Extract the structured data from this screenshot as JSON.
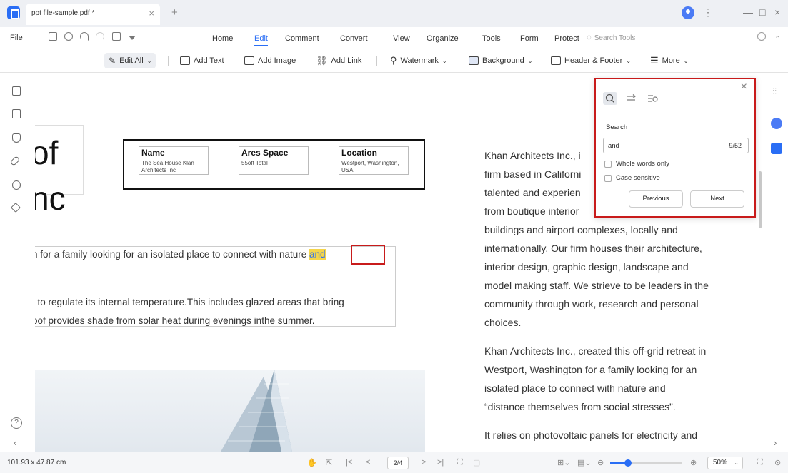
{
  "titlebar": {
    "tab_title": "ppt file-sample.pdf *",
    "tab_close": "×",
    "tab_add": "+",
    "win_menu": "⋮",
    "win_min": "—",
    "win_max": "□",
    "win_close": "×"
  },
  "menubar": {
    "file": "File",
    "items": [
      "Home",
      "Edit",
      "Comment",
      "Convert",
      "View",
      "Organize",
      "Tools",
      "Form",
      "Protect"
    ],
    "active": "Edit",
    "search_tools": "Search Tools"
  },
  "toolbar": {
    "edit_all": "Edit All",
    "add_text": "Add Text",
    "add_image": "Add Image",
    "add_link": "Add Link",
    "watermark": "Watermark",
    "background": "Background",
    "header_footer": "Header & Footer",
    "more": "More"
  },
  "document": {
    "big_line1": "of",
    "big_line2": "nc",
    "table": [
      {
        "header": "Name",
        "value": "The Sea House Klan Architects Inc"
      },
      {
        "header": "Ares Space",
        "value": "55oft Total"
      },
      {
        "header": "Location",
        "value": "Westport, Washington, USA"
      }
    ],
    "left_lines": {
      "line1_pre": "n for a family looking for an isolated place to connect with natur",
      "line1_cursor": "e ",
      "line1_highlight": "and",
      "line2": "; to regulate its internal temperature.This includes glazed areas that bring",
      "line3": "oof provides shade from solar heat during evenings inthe summer."
    },
    "right_lines": [
      "Khan Architects Inc., i",
      "firm based in Californi",
      "talented and experien",
      "from boutique interior",
      "buildings and airport complexes, locally and",
      "internationally. Our firm houses their architecture,",
      "interior design, graphic design, landscape and",
      "model making staff. We strieve to be leaders in the",
      "community through work, research and personal",
      "choices.",
      "Khan Architects Inc., created this off-grid retreat in",
      "Westport, Washington for a family looking for an",
      "isolated place to connect with nature and",
      "“distance themselves from social stresses”.",
      "It relies on photovoltaic panels for electricity and"
    ]
  },
  "search_panel": {
    "label": "Search",
    "query": "and",
    "count": "9/52",
    "whole_words": "Whole words only",
    "case_sensitive": "Case sensitive",
    "previous": "Previous",
    "next": "Next",
    "close": "×"
  },
  "left_sidebar": {
    "help": "?"
  },
  "statusbar": {
    "dimensions": "101.93 x 47.87 cm",
    "page": "2/4",
    "zoom": "50%",
    "zoom_fraction": 0.5
  },
  "colors": {
    "accent": "#2a6ef5",
    "highlight": "#f5d54a",
    "annotation": "#c81b1b"
  }
}
